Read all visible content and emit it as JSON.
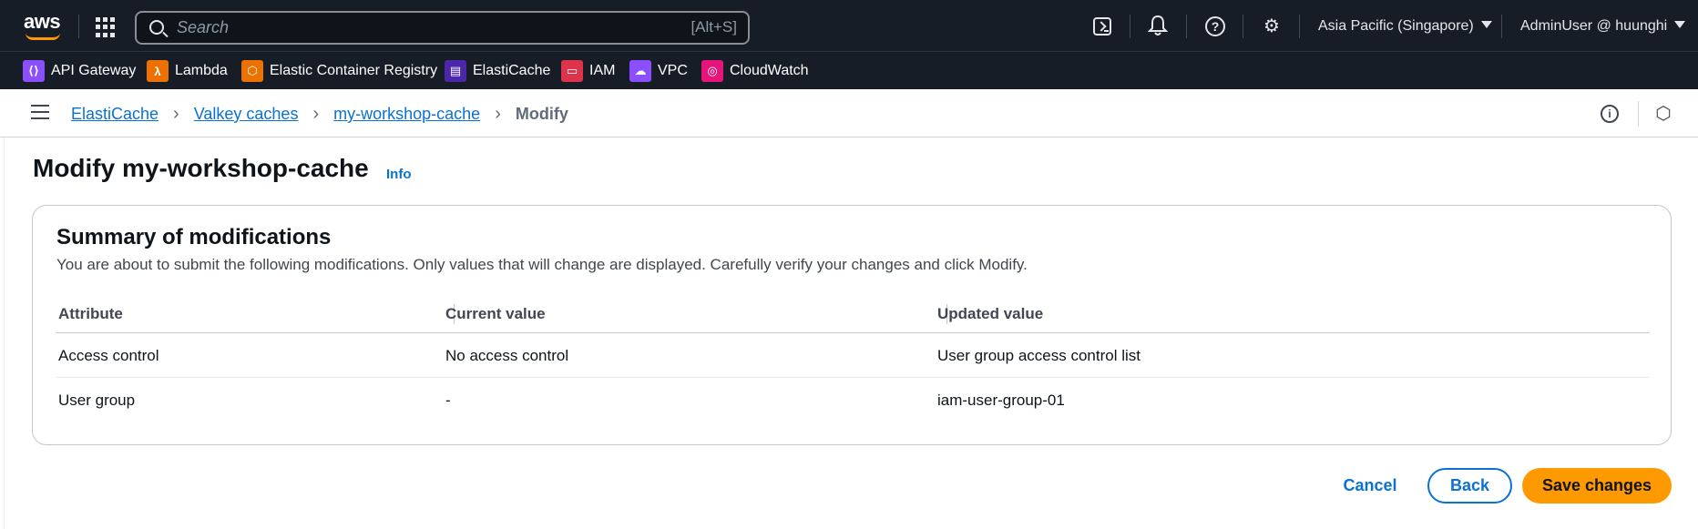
{
  "topnav": {
    "logo_text": "aws",
    "search_placeholder": "Search",
    "search_shortcut": "[Alt+S]",
    "region": "Asia Pacific (Singapore)",
    "account": "AdminUser @ huunghi"
  },
  "favorites": [
    {
      "label": "API Gateway",
      "color": "#8c4fff",
      "glyph": "⟨⟩"
    },
    {
      "label": "Lambda",
      "color": "#ed7100",
      "glyph": "λ"
    },
    {
      "label": "Elastic Container Registry",
      "color": "#ed7100",
      "glyph": "⬡"
    },
    {
      "label": "ElastiCache",
      "color": "#4d27aa",
      "glyph": "▤"
    },
    {
      "label": "IAM",
      "color": "#dd344c",
      "glyph": "▭"
    },
    {
      "label": "VPC",
      "color": "#8c4fff",
      "glyph": "☁"
    },
    {
      "label": "CloudWatch",
      "color": "#e7157b",
      "glyph": "◎"
    }
  ],
  "breadcrumb": {
    "items": [
      "ElastiCache",
      "Valkey caches",
      "my-workshop-cache"
    ],
    "current": "Modify"
  },
  "header": {
    "title": "Modify my-workshop-cache",
    "info": "Info"
  },
  "summary": {
    "title": "Summary of modifications",
    "description": "You are about to submit the following modifications. Only values that will change are displayed. Carefully verify your changes and click Modify.",
    "columns": [
      "Attribute",
      "Current value",
      "Updated value"
    ],
    "rows": [
      [
        "Access control",
        "No access control",
        "User group access control list"
      ],
      [
        "User group",
        "-",
        "iam-user-group-01"
      ]
    ]
  },
  "actions": {
    "cancel": "Cancel",
    "back": "Back",
    "save": "Save changes"
  }
}
